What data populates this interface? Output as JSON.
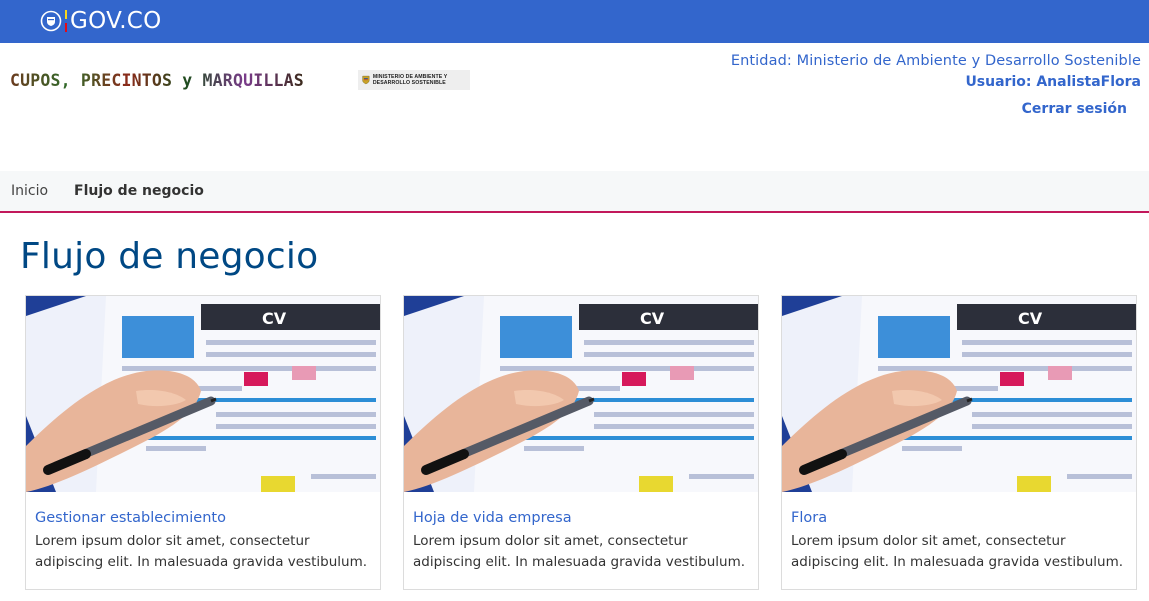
{
  "govbar": {
    "logo_text": "GOV.CO"
  },
  "header": {
    "brand_title": "CUPOS, PRECINTOS y MARQUILLAS",
    "ministry_logo_text": "MINISTERIO DE AMBIENTE Y DESARROLLO SOSTENIBLE",
    "entity": "Entidad: Ministerio de Ambiente y Desarrollo Sostenible",
    "user": "Usuario: AnalistaFlora",
    "logout_label": "Cerrar sesión"
  },
  "tabs": [
    {
      "label": "Inicio",
      "active": false
    },
    {
      "label": "Flujo de negocio",
      "active": true
    }
  ],
  "page_title": "Flujo de negocio",
  "cards": [
    {
      "title": "Gestionar establecimiento",
      "description": "Lorem ipsum dolor sit amet, consectetur adipiscing elit. In malesuada gravida vestibulum.",
      "image_label": "CV"
    },
    {
      "title": "Hoja de vida empresa",
      "description": "Lorem ipsum dolor sit amet, consectetur adipiscing elit. In malesuada gravida vestibulum.",
      "image_label": "CV"
    },
    {
      "title": "Flora",
      "description": "Lorem ipsum dolor sit amet, consectetur adipiscing elit. In malesuada gravida vestibulum.",
      "image_label": "CV"
    }
  ],
  "colors": {
    "gov_blue": "#3366cc",
    "title_blue": "#004884",
    "tab_accent": "#c2185b"
  }
}
